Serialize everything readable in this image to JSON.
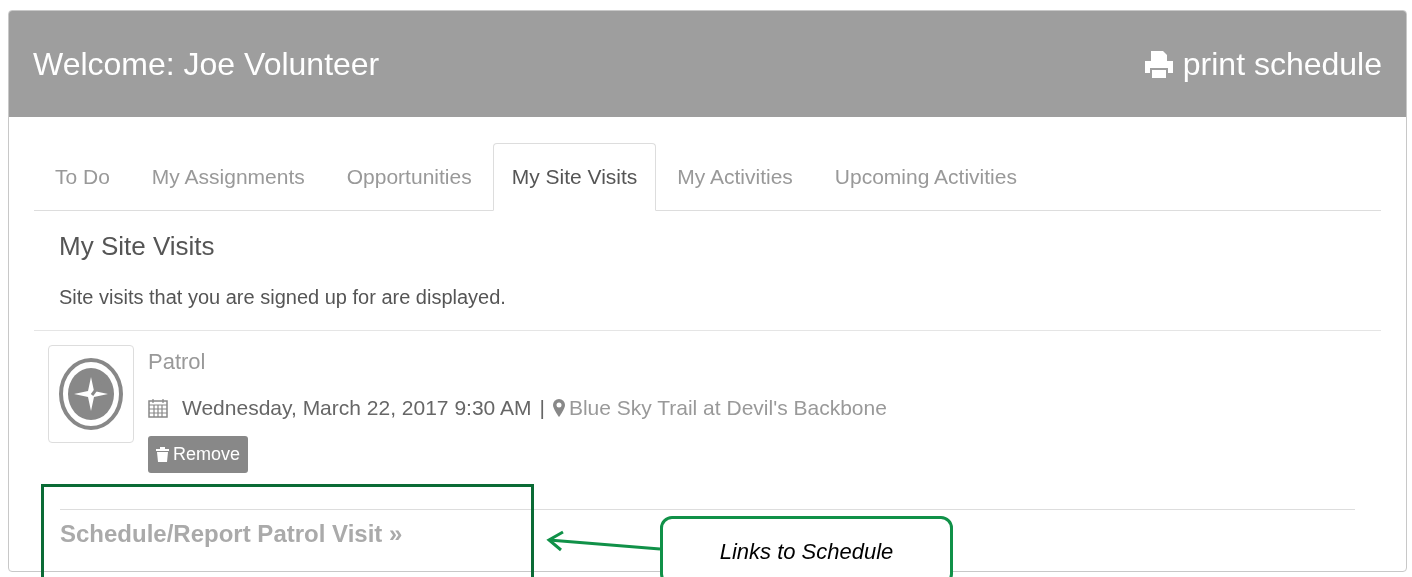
{
  "header": {
    "title": "Welcome: Joe Volunteer",
    "print_link": "print schedule"
  },
  "tabs": [
    {
      "label": "To Do",
      "selected": false
    },
    {
      "label": "My Assignments",
      "selected": false
    },
    {
      "label": "Opportunities",
      "selected": false
    },
    {
      "label": "My Site Visits",
      "selected": true
    },
    {
      "label": "My Activities",
      "selected": false
    },
    {
      "label": "Upcoming Activities",
      "selected": false
    }
  ],
  "section": {
    "title": "My Site Visits",
    "description": "Site visits that you are signed up for are displayed."
  },
  "visits": [
    {
      "type": "Patrol",
      "datetime": "Wednesday, March 22, 2017 9:30 AM",
      "separator": "|",
      "location": "Blue Sky Trail at Devil's Backbone",
      "remove_button": "Remove"
    }
  ],
  "schedule_link": "Schedule/Report Patrol Visit »",
  "annotation": {
    "callout": "Links to Schedule"
  }
}
